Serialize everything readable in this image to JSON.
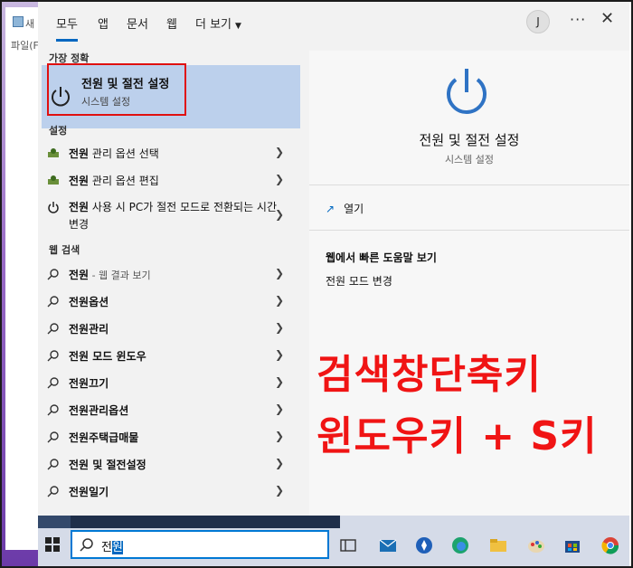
{
  "background_window": {
    "title_fragment": "새",
    "menu_fragment": "파일(F"
  },
  "tabs": [
    {
      "label": "모두",
      "active": true
    },
    {
      "label": "앱",
      "active": false
    },
    {
      "label": "문서",
      "active": false
    },
    {
      "label": "웹",
      "active": false
    },
    {
      "label": "더 보기",
      "active": false
    }
  ],
  "header": {
    "avatar_initial": "J",
    "more_label": "···",
    "close_label": "✕"
  },
  "best_match": {
    "heading": "가장 정확",
    "title": "전원 및 절전 설정",
    "subtitle": "시스템 설정"
  },
  "settings": {
    "heading": "설정",
    "items": [
      {
        "bold": "전원",
        "text": " 관리 옵션 선택"
      },
      {
        "bold": "전원",
        "text": " 관리 옵션 편집"
      },
      {
        "bold": "전원",
        "text": " 사용 시 PC가 절전 모드로 전환되는 시간 변경"
      }
    ]
  },
  "web_search": {
    "heading": "웹 검색",
    "items": [
      {
        "bold": "전원",
        "text": "",
        "sub": " - 웹 결과 보기"
      },
      {
        "bold": "전원",
        "text": "옵션",
        "sub": ""
      },
      {
        "bold": "전원",
        "text": "관리",
        "sub": ""
      },
      {
        "bold": "전원",
        "text": " 모드 윈도우",
        "sub": ""
      },
      {
        "bold": "전원",
        "text": "끄기",
        "sub": ""
      },
      {
        "bold": "전원",
        "text": "관리옵션",
        "sub": ""
      },
      {
        "bold": "전원",
        "text": "주택급매물",
        "sub": ""
      },
      {
        "bold": "전원",
        "text": " 및 절전설정",
        "sub": ""
      },
      {
        "bold": "전원",
        "text": "일기",
        "sub": ""
      }
    ]
  },
  "detail": {
    "title": "전원 및 절전 설정",
    "subtitle": "시스템 설정",
    "open_label": "열기",
    "help_heading": "웹에서 빠른 도움말 보기",
    "help_item": "전원 모드 변경"
  },
  "caption": {
    "line1": "검색창단축키",
    "line2": "윈도우키 + S키"
  },
  "search": {
    "prefix": "전",
    "selected": "원"
  },
  "colors": {
    "accent": "#0067c0",
    "highlight": "#bcd0ec",
    "caption_red": "#f01414"
  }
}
